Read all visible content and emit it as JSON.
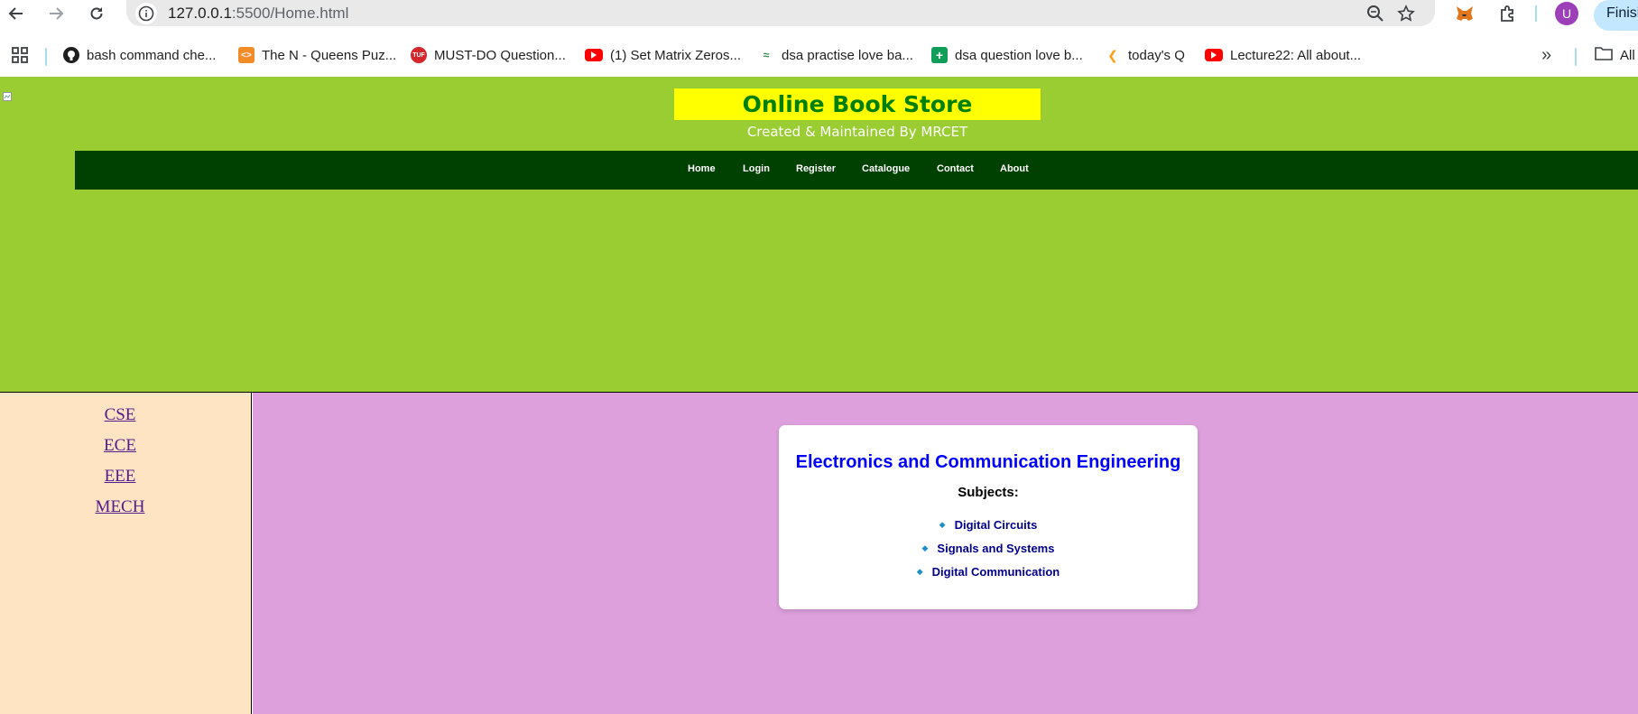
{
  "browser": {
    "url_host": "127.0.0.1",
    "url_rest": ":5500/Home.html",
    "profile_initial": "U",
    "finish_label": "Finish",
    "all_bookmarks_label": "All",
    "bookmarks": [
      {
        "label": "bash command che...",
        "icon": "github-icon"
      },
      {
        "label": "The N - Queens Puz...",
        "icon": "codingninjas-icon"
      },
      {
        "label": "MUST-DO Question...",
        "icon": "tuf-icon"
      },
      {
        "label": "(1) Set Matrix Zeros...",
        "icon": "youtube-icon"
      },
      {
        "label": "dsa practise love ba...",
        "icon": "gfg-icon"
      },
      {
        "label": "dsa question love b...",
        "icon": "sheets-icon"
      },
      {
        "label": "today's Q",
        "icon": "leetcode-icon"
      },
      {
        "label": "Lecture22: All about...",
        "icon": "youtube-icon"
      }
    ],
    "colors": {
      "omnibox": "#e9e9ea",
      "profile": "#9c3fb8",
      "finish": "#c2e7ff"
    }
  },
  "header": {
    "title": "Online Book Store",
    "subtitle": "Created & Maintained By MRCET",
    "nav": [
      "Home",
      "Login",
      "Register",
      "Catalogue",
      "Contact",
      "About"
    ],
    "colors": {
      "background": "#9acd32",
      "title_box": "#ffff00",
      "title_text": "#008000",
      "navbar": "#004000"
    }
  },
  "sidebar": {
    "links": [
      "CSE",
      "ECE",
      "EEE",
      "MECH"
    ],
    "colors": {
      "background": "#ffe4c4",
      "link": "#551a8b"
    }
  },
  "main": {
    "card": {
      "title": "Electronics and Communication Engineering",
      "subjects_label": "Subjects:",
      "subjects": [
        "Digital Circuits",
        "Signals and Systems",
        "Digital Communication"
      ]
    },
    "colors": {
      "background": "#dda0dd",
      "title": "#0000ff",
      "subject": "#00008b"
    }
  }
}
